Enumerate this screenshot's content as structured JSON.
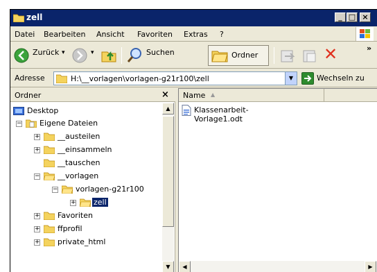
{
  "window": {
    "title": "zell",
    "min": "_",
    "max": "□",
    "close": "×"
  },
  "menu": [
    "Datei",
    "Bearbeiten",
    "Ansicht",
    "Favoriten",
    "Extras",
    "?"
  ],
  "toolbar": {
    "back_label": "Zurück",
    "search_label": "Suchen",
    "folders_label": "Ordner",
    "overflow": "»",
    "delete_glyph": "✕"
  },
  "address": {
    "label": "Adresse",
    "value": "H:\\__vorlagen\\vorlagen-g21r100\\zell",
    "go_label": "Wechseln zu"
  },
  "folder_pane": {
    "title": "Ordner",
    "close": "×",
    "tree": [
      {
        "label": "Desktop",
        "expander": ""
      },
      {
        "label": "Eigene Dateien",
        "expander": "−"
      },
      {
        "label": "__austeilen",
        "expander": "+"
      },
      {
        "label": "__einsammeln",
        "expander": "+"
      },
      {
        "label": "__tauschen",
        "expander": ""
      },
      {
        "label": "__vorlagen",
        "expander": "−"
      },
      {
        "label": "vorlagen-g21r100",
        "expander": "−"
      },
      {
        "label": "zell",
        "expander": "+"
      },
      {
        "label": "Favoriten",
        "expander": "+"
      },
      {
        "label": "ffprofil",
        "expander": "+"
      },
      {
        "label": "private_html",
        "expander": "+"
      }
    ]
  },
  "file_pane": {
    "column_name": "Name",
    "sort_arrow": "▲",
    "files": [
      {
        "name": "Klassenarbeit-Vorlage1.odt",
        "icon": "odt-document-icon"
      }
    ]
  },
  "colors": {
    "titlebar": "#0a246a",
    "window_bg": "#ece9d8",
    "folder": "#f4d35e",
    "selected": "#0a246a"
  }
}
